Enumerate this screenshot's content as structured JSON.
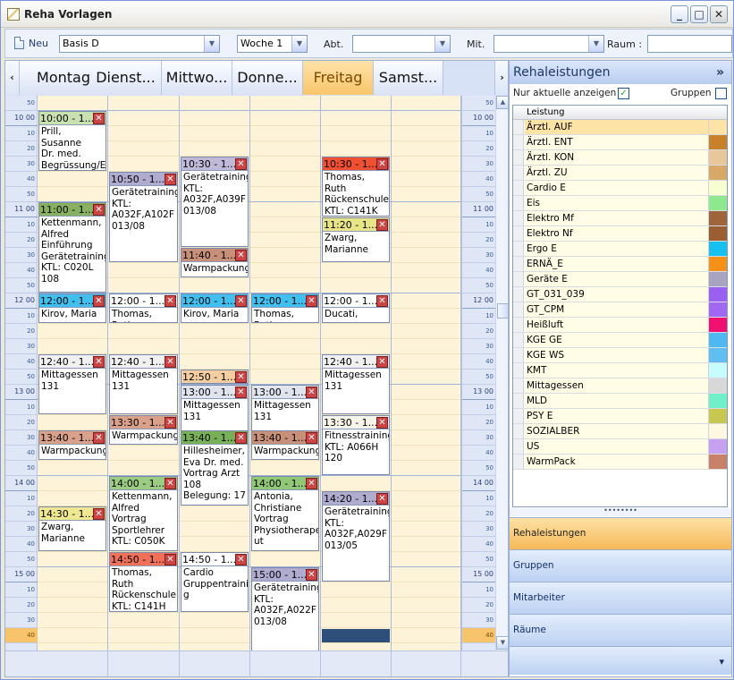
{
  "window": {
    "title": "Reha Vorlagen",
    "min": "_",
    "max": "□",
    "close": "✕"
  },
  "toolbar": {
    "new_label": "Neu",
    "template": "Basis D",
    "week": "Woche 1",
    "abt_label": "Abt.",
    "abt_value": "",
    "mit_label": "Mit.",
    "mit_value": "",
    "raum_label": "Raum :",
    "raum_value": ""
  },
  "calendar": {
    "nav_prev": "‹",
    "nav_next": "›",
    "days": [
      "Montag",
      "Dienst...",
      "Mittwo...",
      "Donne...",
      "Freitag",
      "Samst..."
    ],
    "today_index": 4,
    "times": [
      {
        "label": "50",
        "hour": false
      },
      {
        "label": "10 00",
        "hour": true
      },
      {
        "label": "10",
        "hour": false
      },
      {
        "label": "20",
        "hour": false
      },
      {
        "label": "30",
        "hour": false
      },
      {
        "label": "40",
        "hour": false
      },
      {
        "label": "50",
        "hour": false
      },
      {
        "label": "11 00",
        "hour": true
      },
      {
        "label": "10",
        "hour": false
      },
      {
        "label": "20",
        "hour": false
      },
      {
        "label": "30",
        "hour": false
      },
      {
        "label": "40",
        "hour": false
      },
      {
        "label": "50",
        "hour": false
      },
      {
        "label": "12 00",
        "hour": true
      },
      {
        "label": "10",
        "hour": false
      },
      {
        "label": "20",
        "hour": false
      },
      {
        "label": "30",
        "hour": false
      },
      {
        "label": "40",
        "hour": false
      },
      {
        "label": "50",
        "hour": false
      },
      {
        "label": "13 00",
        "hour": true
      },
      {
        "label": "10",
        "hour": false
      },
      {
        "label": "20",
        "hour": false
      },
      {
        "label": "30",
        "hour": false
      },
      {
        "label": "40",
        "hour": false
      },
      {
        "label": "50",
        "hour": false
      },
      {
        "label": "14 00",
        "hour": true
      },
      {
        "label": "10",
        "hour": false
      },
      {
        "label": "20",
        "hour": false
      },
      {
        "label": "30",
        "hour": false
      },
      {
        "label": "40",
        "hour": false
      },
      {
        "label": "50",
        "hour": false
      },
      {
        "label": "15 00",
        "hour": true
      },
      {
        "label": "10",
        "hour": false
      },
      {
        "label": "20",
        "hour": false
      },
      {
        "label": "30",
        "hour": false
      },
      {
        "label": "40",
        "hour": false,
        "highlight": true
      }
    ],
    "events": [
      {
        "day": 0,
        "start": 1,
        "len": 4,
        "time": "10:00 - 1...",
        "color": "#c9e0b0",
        "text": "Prill, Susanne\nDr. med.\nBegrüssung/Ei"
      },
      {
        "day": 0,
        "start": 7,
        "len": 6,
        "time": "11:00 - 1...",
        "color": "#87b060",
        "text": "Kettenmann,\nAlfred\nEinführung\nGerätetraining\nKTL: C020L\n108"
      },
      {
        "day": 0,
        "start": 13,
        "len": 2,
        "time": "12:00 - 1...",
        "color": "#41c0f0",
        "text": "Kirov, Maria"
      },
      {
        "day": 0,
        "start": 17,
        "len": 4,
        "time": "12:40 - 1...",
        "color": "#f0f0f0",
        "text": "Mittagessen\n131"
      },
      {
        "day": 0,
        "start": 22,
        "len": 2,
        "time": "13:40 - 1...",
        "color": "#d9a08a",
        "text": "Warmpackung"
      },
      {
        "day": 0,
        "start": 27,
        "len": 3,
        "time": "14:30 - 1...",
        "color": "#f0e890",
        "text": "Zwarg,\nMarianne"
      },
      {
        "day": 1,
        "start": 5,
        "len": 6,
        "time": "10:50 - 1...",
        "color": "#b0acd0",
        "text": "Gerätetraining\nKTL:\nA032F,A102F\n013/08"
      },
      {
        "day": 1,
        "start": 13,
        "len": 2,
        "time": "12:00 - 1...",
        "color": "#ffffff",
        "text": "Thomas, Ruth"
      },
      {
        "day": 1,
        "start": 17,
        "len": 4,
        "time": "12:40 - 1...",
        "color": "#f0f0f0",
        "text": "Mittagessen\n131"
      },
      {
        "day": 1,
        "start": 21,
        "len": 2,
        "time": "13:30 - 1...",
        "color": "#d9a08a",
        "text": "Warmpackung"
      },
      {
        "day": 1,
        "start": 25,
        "len": 5,
        "time": "14:00 - 1...",
        "color": "#9ccc82",
        "text": "Kettenmann,\nAlfred\nVortrag\nSportlehrer\nKTL: C050K"
      },
      {
        "day": 1,
        "start": 30,
        "len": 4,
        "time": "14:50 - 1...",
        "color": "#f07058",
        "text": "Thomas, Ruth\nRückenschule\nKTL: C141H"
      },
      {
        "day": 2,
        "start": 4,
        "len": 6,
        "time": "10:30 - 1...",
        "color": "#c0bad8",
        "text": "Gerätetraining\nKTL:\nA032F,A039F\n013/08"
      },
      {
        "day": 2,
        "start": 10,
        "len": 2,
        "time": "11:40 - 1...",
        "color": "#c89078",
        "text": "Warmpackung"
      },
      {
        "day": 2,
        "start": 13,
        "len": 2,
        "time": "12:00 - 1...",
        "color": "#41c0f0",
        "text": "Kirov, Maria"
      },
      {
        "day": 2,
        "start": 18,
        "len": 1,
        "time": "12:50 - 1...",
        "color": "#f2cea0",
        "text": ""
      },
      {
        "day": 2,
        "start": 19,
        "len": 4,
        "time": "13:00 - 1...",
        "color": "#e0e4ec",
        "text": "Mittagessen\n131"
      },
      {
        "day": 2,
        "start": 22,
        "len": 5,
        "time": "13:40 - 1...",
        "color": "#78b058",
        "text": "Hillesheimer,\nEva Dr. med.\nVortrag Arzt\n108\nBelegung: 17"
      },
      {
        "day": 2,
        "start": 30,
        "len": 4,
        "time": "14:50 - 1...",
        "color": "#ffffff",
        "text": "Cardio\nGruppentrainin\ng"
      },
      {
        "day": 3,
        "start": 13,
        "len": 2,
        "time": "12:00 - 1...",
        "color": "#41c0f0",
        "text": "Thomas, Ruth"
      },
      {
        "day": 3,
        "start": 19,
        "len": 4,
        "time": "13:00 - 1...",
        "color": "#e0e4ec",
        "text": "Mittagessen\n131"
      },
      {
        "day": 3,
        "start": 22,
        "len": 2,
        "time": "13:40 - 1...",
        "color": "#c89078",
        "text": "Warmpackung"
      },
      {
        "day": 3,
        "start": 25,
        "len": 5,
        "time": "14:00 - 1...",
        "color": "#90c878",
        "text": "Antonia,\nChristiane\nVortrag\nPhysiotherape\nut"
      },
      {
        "day": 3,
        "start": 31,
        "len": 6,
        "time": "15:00 - 1...",
        "color": "#b0acd0",
        "text": "Gerätetraining\nKTL:\nA032F,A022F\n013/08"
      },
      {
        "day": 4,
        "start": 4,
        "len": 4,
        "time": "10:30 - 1...",
        "color": "#f05030",
        "text": "Thomas, Ruth\nRückenschule\nKTL: C141K"
      },
      {
        "day": 4,
        "start": 8,
        "len": 3,
        "time": "11:20 - 1...",
        "color": "#e8e488",
        "text": "Zwarg,\nMarianne"
      },
      {
        "day": 4,
        "start": 13,
        "len": 2,
        "time": "12:00 - 1...",
        "color": "#ffffff",
        "text": "Ducati,"
      },
      {
        "day": 4,
        "start": 17,
        "len": 4,
        "time": "12:40 - 1...",
        "color": "#f0f0f0",
        "text": "Mittagessen\n131"
      },
      {
        "day": 4,
        "start": 21,
        "len": 4,
        "time": "13:30 - 1...",
        "color": "#f7f4ea",
        "text": "Fitnesstraining\nKTL: A066H\n120"
      },
      {
        "day": 4,
        "start": 26,
        "len": 6,
        "time": "14:20 - 1...",
        "color": "#b0acd0",
        "text": "Gerätetraining\nKTL:\nA032F,A029F\n013/05"
      }
    ]
  },
  "panel": {
    "title": "Rehaleistungen",
    "collapse": "»",
    "only_current_label": "Nur aktuelle anzeigen",
    "only_current_checked": "✓",
    "groups_label": "Gruppen",
    "list_header": "Leistung",
    "items": [
      {
        "name": "Ärztl. AUF",
        "color": "#fde3a5",
        "sel": true
      },
      {
        "name": "Ärztl. ENT",
        "color": "#c8802a"
      },
      {
        "name": "Ärztl. KON",
        "color": "#e8c89a"
      },
      {
        "name": "Ärztl. ZU",
        "color": "#d8a868"
      },
      {
        "name": "Cardio E",
        "color": "#f7ffd0"
      },
      {
        "name": "Eis",
        "color": "#8ee88e"
      },
      {
        "name": "Elektro Mf",
        "color": "#a0643a"
      },
      {
        "name": "Elektro Nf",
        "color": "#9a5e32"
      },
      {
        "name": "Ergo E",
        "color": "#18c0f0"
      },
      {
        "name": "ERNÄ_E",
        "color": "#f59018"
      },
      {
        "name": "Geräte E",
        "color": "#a8a4c0"
      },
      {
        "name": "GT_031_039",
        "color": "#9a60f0"
      },
      {
        "name": "GT_CPM",
        "color": "#a068f0"
      },
      {
        "name": "Heißluft",
        "color": "#f01070"
      },
      {
        "name": "KGE GE",
        "color": "#50b8f0"
      },
      {
        "name": "KGE WS",
        "color": "#60bef0"
      },
      {
        "name": "KMT",
        "color": "#c8fcfc"
      },
      {
        "name": "Mittagessen",
        "color": "#d8d8d8"
      },
      {
        "name": "MLD",
        "color": "#70f0c8"
      },
      {
        "name": "PSY E",
        "color": "#c8c850"
      },
      {
        "name": "SOZIALBER",
        "color": "#fff8e0"
      },
      {
        "name": "US",
        "color": "#c8a0f0"
      },
      {
        "name": "WarmPack",
        "color": "#c88068"
      }
    ],
    "nav": [
      "Rehaleistungen",
      "Gruppen",
      "Mitarbeiter",
      "Räume"
    ],
    "nav_more": "▾"
  }
}
